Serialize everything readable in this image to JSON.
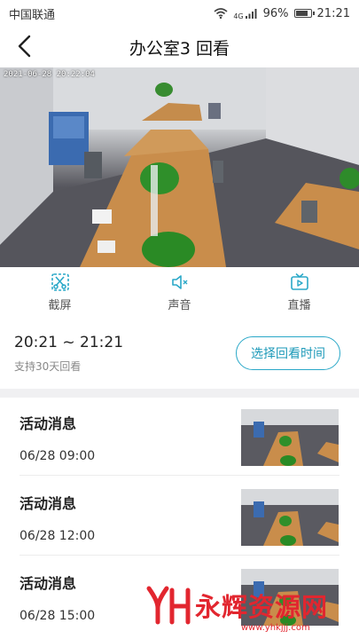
{
  "status": {
    "carrier": "中国联通",
    "signal_type": "4G",
    "battery_percent": 96,
    "battery_text": "96%",
    "time": "21:21"
  },
  "nav": {
    "back_icon": "chevron-left-icon",
    "title": "办公室3 回看"
  },
  "video": {
    "timestamp": "2021-06-28 20:22:04"
  },
  "actions": [
    {
      "label": "截屏",
      "icon": "scissors-icon"
    },
    {
      "label": "声音",
      "icon": "speaker-muted-icon"
    },
    {
      "label": "直播",
      "icon": "tv-play-icon"
    }
  ],
  "playback": {
    "range": "20:21 ~ 21:21",
    "hint": "支持30天回看",
    "choose_label": "选择回看时间"
  },
  "events": [
    {
      "title": "活动消息",
      "time": "06/28 09:00"
    },
    {
      "title": "活动消息",
      "time": "06/28 12:00"
    },
    {
      "title": "活动消息",
      "time": "06/28 15:00"
    }
  ],
  "watermark": {
    "brand": "永辉资源网",
    "url": "www.yhkjjj.com"
  },
  "colors": {
    "accent": "#2aa8c8",
    "watermark": "#e2262f"
  }
}
